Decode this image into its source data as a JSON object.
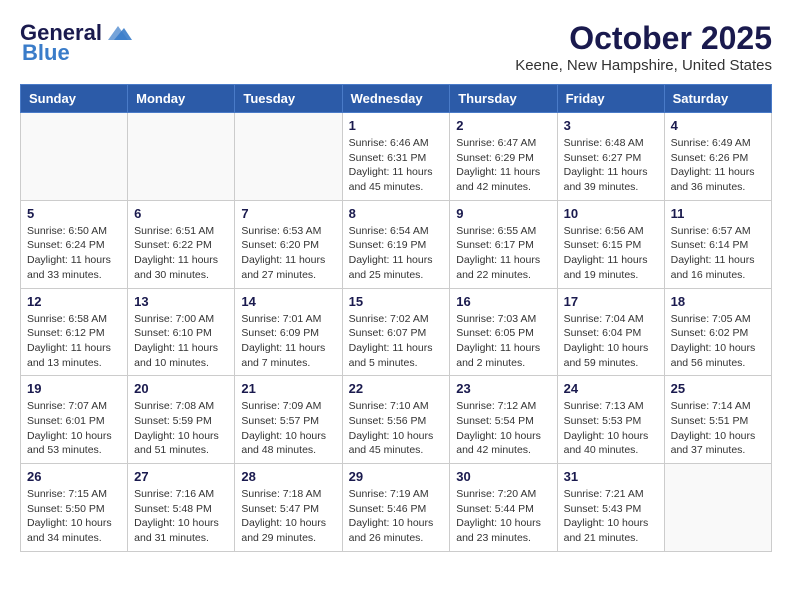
{
  "header": {
    "logo_general": "General",
    "logo_blue": "Blue",
    "month_title": "October 2025",
    "location": "Keene, New Hampshire, United States"
  },
  "weekdays": [
    "Sunday",
    "Monday",
    "Tuesday",
    "Wednesday",
    "Thursday",
    "Friday",
    "Saturday"
  ],
  "weeks": [
    [
      {
        "day": "",
        "info": ""
      },
      {
        "day": "",
        "info": ""
      },
      {
        "day": "",
        "info": ""
      },
      {
        "day": "1",
        "info": "Sunrise: 6:46 AM\nSunset: 6:31 PM\nDaylight: 11 hours\nand 45 minutes."
      },
      {
        "day": "2",
        "info": "Sunrise: 6:47 AM\nSunset: 6:29 PM\nDaylight: 11 hours\nand 42 minutes."
      },
      {
        "day": "3",
        "info": "Sunrise: 6:48 AM\nSunset: 6:27 PM\nDaylight: 11 hours\nand 39 minutes."
      },
      {
        "day": "4",
        "info": "Sunrise: 6:49 AM\nSunset: 6:26 PM\nDaylight: 11 hours\nand 36 minutes."
      }
    ],
    [
      {
        "day": "5",
        "info": "Sunrise: 6:50 AM\nSunset: 6:24 PM\nDaylight: 11 hours\nand 33 minutes."
      },
      {
        "day": "6",
        "info": "Sunrise: 6:51 AM\nSunset: 6:22 PM\nDaylight: 11 hours\nand 30 minutes."
      },
      {
        "day": "7",
        "info": "Sunrise: 6:53 AM\nSunset: 6:20 PM\nDaylight: 11 hours\nand 27 minutes."
      },
      {
        "day": "8",
        "info": "Sunrise: 6:54 AM\nSunset: 6:19 PM\nDaylight: 11 hours\nand 25 minutes."
      },
      {
        "day": "9",
        "info": "Sunrise: 6:55 AM\nSunset: 6:17 PM\nDaylight: 11 hours\nand 22 minutes."
      },
      {
        "day": "10",
        "info": "Sunrise: 6:56 AM\nSunset: 6:15 PM\nDaylight: 11 hours\nand 19 minutes."
      },
      {
        "day": "11",
        "info": "Sunrise: 6:57 AM\nSunset: 6:14 PM\nDaylight: 11 hours\nand 16 minutes."
      }
    ],
    [
      {
        "day": "12",
        "info": "Sunrise: 6:58 AM\nSunset: 6:12 PM\nDaylight: 11 hours\nand 13 minutes."
      },
      {
        "day": "13",
        "info": "Sunrise: 7:00 AM\nSunset: 6:10 PM\nDaylight: 11 hours\nand 10 minutes."
      },
      {
        "day": "14",
        "info": "Sunrise: 7:01 AM\nSunset: 6:09 PM\nDaylight: 11 hours\nand 7 minutes."
      },
      {
        "day": "15",
        "info": "Sunrise: 7:02 AM\nSunset: 6:07 PM\nDaylight: 11 hours\nand 5 minutes."
      },
      {
        "day": "16",
        "info": "Sunrise: 7:03 AM\nSunset: 6:05 PM\nDaylight: 11 hours\nand 2 minutes."
      },
      {
        "day": "17",
        "info": "Sunrise: 7:04 AM\nSunset: 6:04 PM\nDaylight: 10 hours\nand 59 minutes."
      },
      {
        "day": "18",
        "info": "Sunrise: 7:05 AM\nSunset: 6:02 PM\nDaylight: 10 hours\nand 56 minutes."
      }
    ],
    [
      {
        "day": "19",
        "info": "Sunrise: 7:07 AM\nSunset: 6:01 PM\nDaylight: 10 hours\nand 53 minutes."
      },
      {
        "day": "20",
        "info": "Sunrise: 7:08 AM\nSunset: 5:59 PM\nDaylight: 10 hours\nand 51 minutes."
      },
      {
        "day": "21",
        "info": "Sunrise: 7:09 AM\nSunset: 5:57 PM\nDaylight: 10 hours\nand 48 minutes."
      },
      {
        "day": "22",
        "info": "Sunrise: 7:10 AM\nSunset: 5:56 PM\nDaylight: 10 hours\nand 45 minutes."
      },
      {
        "day": "23",
        "info": "Sunrise: 7:12 AM\nSunset: 5:54 PM\nDaylight: 10 hours\nand 42 minutes."
      },
      {
        "day": "24",
        "info": "Sunrise: 7:13 AM\nSunset: 5:53 PM\nDaylight: 10 hours\nand 40 minutes."
      },
      {
        "day": "25",
        "info": "Sunrise: 7:14 AM\nSunset: 5:51 PM\nDaylight: 10 hours\nand 37 minutes."
      }
    ],
    [
      {
        "day": "26",
        "info": "Sunrise: 7:15 AM\nSunset: 5:50 PM\nDaylight: 10 hours\nand 34 minutes."
      },
      {
        "day": "27",
        "info": "Sunrise: 7:16 AM\nSunset: 5:48 PM\nDaylight: 10 hours\nand 31 minutes."
      },
      {
        "day": "28",
        "info": "Sunrise: 7:18 AM\nSunset: 5:47 PM\nDaylight: 10 hours\nand 29 minutes."
      },
      {
        "day": "29",
        "info": "Sunrise: 7:19 AM\nSunset: 5:46 PM\nDaylight: 10 hours\nand 26 minutes."
      },
      {
        "day": "30",
        "info": "Sunrise: 7:20 AM\nSunset: 5:44 PM\nDaylight: 10 hours\nand 23 minutes."
      },
      {
        "day": "31",
        "info": "Sunrise: 7:21 AM\nSunset: 5:43 PM\nDaylight: 10 hours\nand 21 minutes."
      },
      {
        "day": "",
        "info": ""
      }
    ]
  ]
}
